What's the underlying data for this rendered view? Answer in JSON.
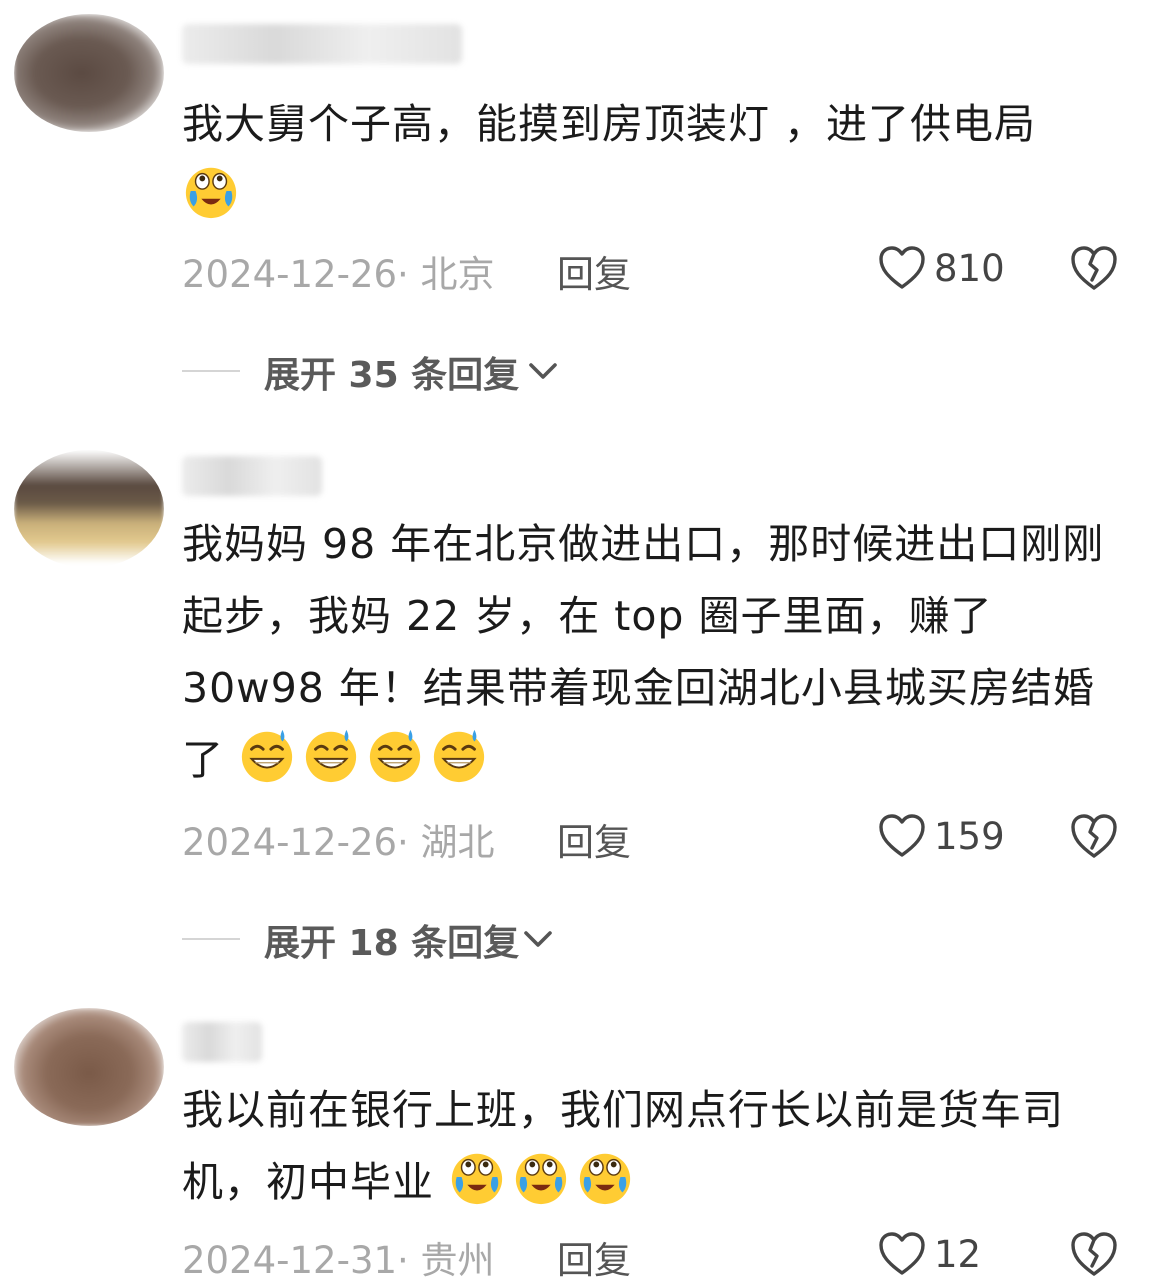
{
  "comments": [
    {
      "text": "我大舅个子高，能摸到房顶装灯 ，进了供电局",
      "emojis": [
        "cry-laugh-emoji"
      ],
      "date_location": "2024-12-26· 北京",
      "reply_label": "回复",
      "likes": "810",
      "expand_label": "展开 35 条回复"
    },
    {
      "text": "我妈妈 98 年在北京做进出口，那时候进出口刚刚起步，我妈 22 岁，在 top 圈子里面，赚了 30w98 年！结果带着现金回湖北小县城买房结婚了",
      "emojis": [
        "sweat-grin-emoji",
        "sweat-grin-emoji",
        "sweat-grin-emoji",
        "sweat-grin-emoji"
      ],
      "date_location": "2024-12-26· 湖北",
      "reply_label": "回复",
      "likes": "159",
      "expand_label": "展开 18 条回复"
    },
    {
      "text": "我以前在银行上班，我们网点行长以前是货车司机，初中毕业",
      "emojis": [
        "cry-laugh-emoji",
        "cry-laugh-emoji",
        "cry-laugh-emoji"
      ],
      "date_location": "2024-12-31· 贵州",
      "reply_label": "回复",
      "likes": "12"
    }
  ],
  "colors": {
    "meta_gray": "#a8a8a8",
    "text": "#1b1b1b",
    "emoji_yellow": "#ffcc33",
    "tear_blue": "#3aa0e6"
  }
}
